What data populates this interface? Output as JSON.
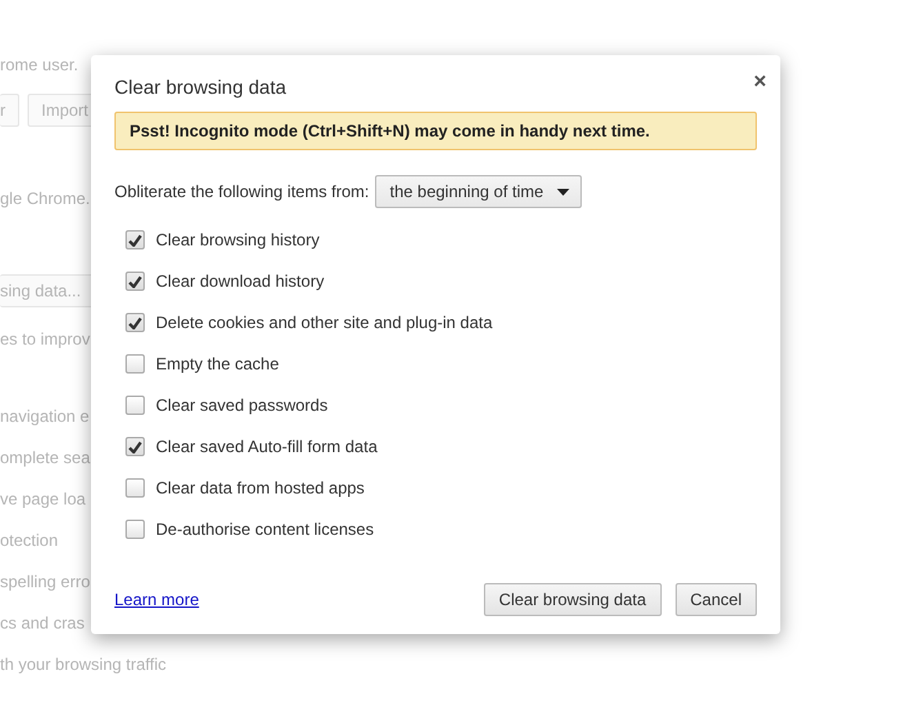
{
  "background_page": [
    {
      "kind": "text",
      "text": "rome user."
    },
    {
      "kind": "buttons",
      "buttons": [
        "r",
        "Import"
      ]
    },
    {
      "kind": "text",
      "text": "gle Chrome."
    },
    {
      "kind": "button",
      "text": "sing data..."
    },
    {
      "kind": "text",
      "text": "es to improv"
    },
    {
      "kind": "text",
      "text": "navigation e"
    },
    {
      "kind": "text",
      "text": "omplete sea"
    },
    {
      "kind": "text",
      "text": "ve page loa"
    },
    {
      "kind": "text",
      "text": "otection"
    },
    {
      "kind": "text",
      "text": "spelling erro"
    },
    {
      "kind": "text",
      "text": "cs and cras"
    },
    {
      "kind": "text",
      "text": "th your browsing traffic"
    }
  ],
  "dialog": {
    "title": "Clear browsing data",
    "close": "×",
    "banner": "Psst! Incognito mode (Ctrl+Shift+N) may come in handy next time.",
    "period_label": "Obliterate the following items from:",
    "period_value": "the beginning of time",
    "items": [
      {
        "label": "Clear browsing history",
        "checked": true
      },
      {
        "label": "Clear download history",
        "checked": true
      },
      {
        "label": "Delete cookies and other site and plug-in data",
        "checked": true
      },
      {
        "label": "Empty the cache",
        "checked": false
      },
      {
        "label": "Clear saved passwords",
        "checked": false
      },
      {
        "label": "Clear saved Auto-fill form data",
        "checked": true
      },
      {
        "label": "Clear data from hosted apps",
        "checked": false
      },
      {
        "label": "De-authorise content licenses",
        "checked": false
      }
    ],
    "link": "Learn more",
    "buttons": [
      "Clear browsing data",
      "Cancel"
    ]
  }
}
